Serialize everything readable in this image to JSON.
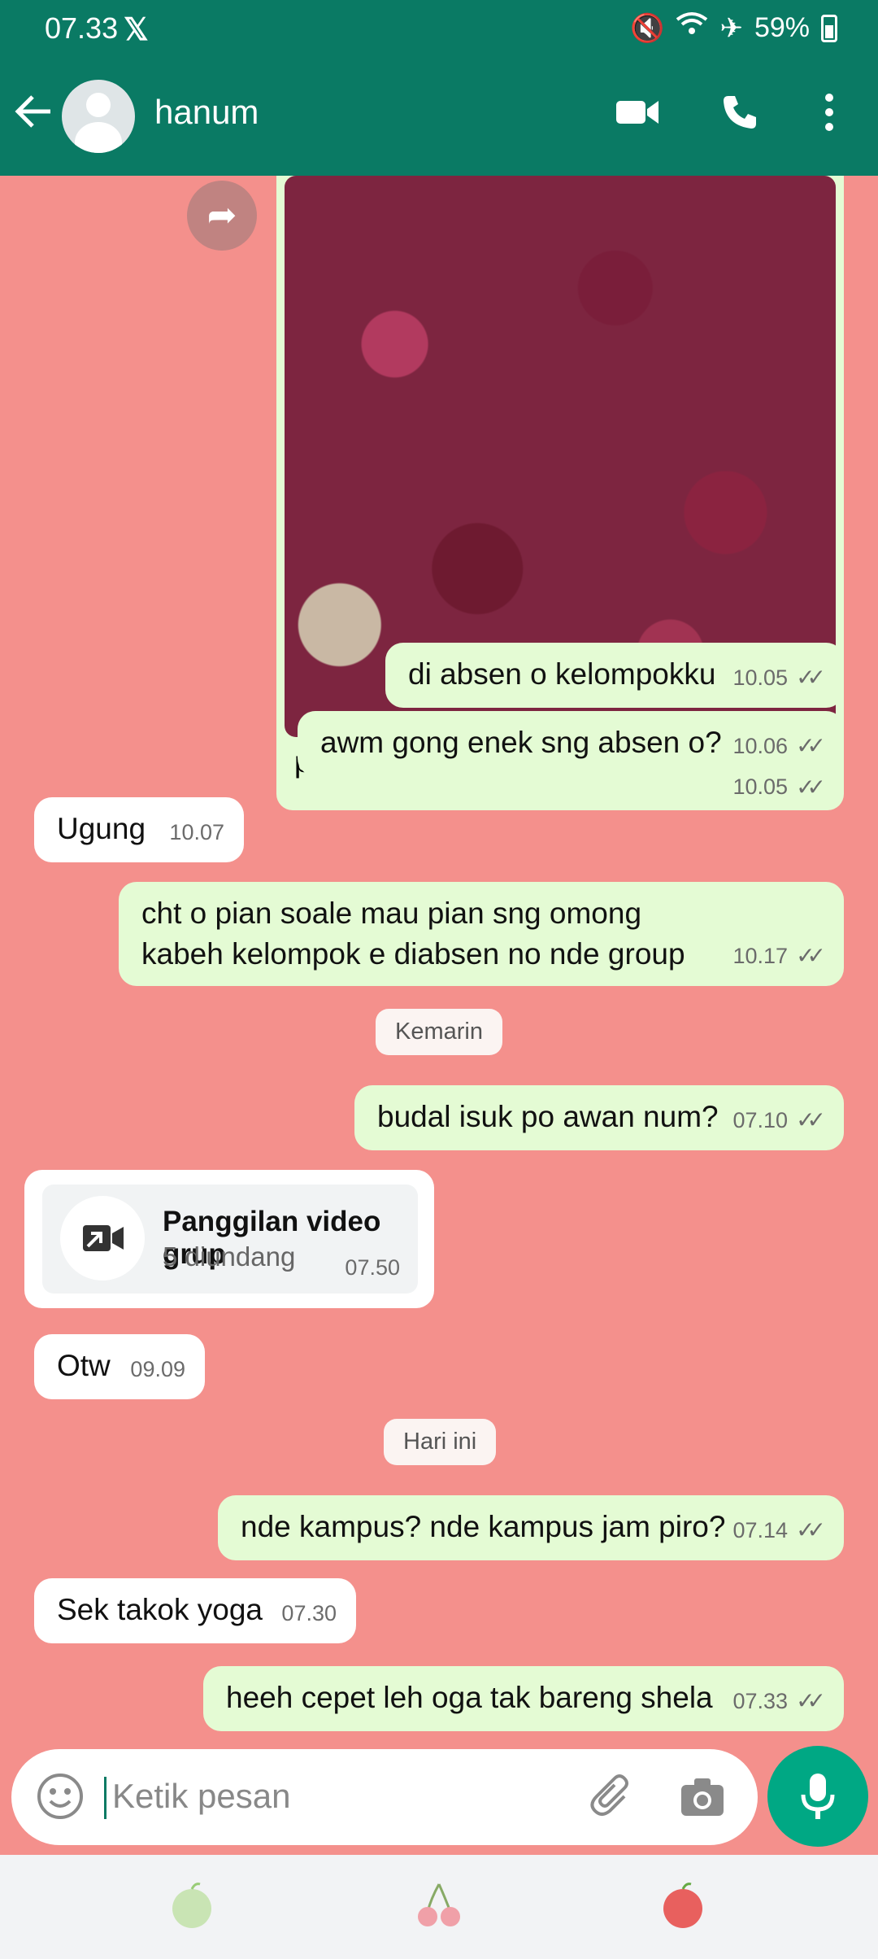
{
  "status_bar": {
    "time": "07.33",
    "app_icon": "x-logo",
    "battery": "59%"
  },
  "header": {
    "contact_name": "hanum",
    "icons": [
      "back-arrow-icon",
      "avatar",
      "video-call-icon",
      "phone-icon",
      "more-options-icon"
    ]
  },
  "messages": {
    "photo": {
      "caption": "pritil",
      "time": "10.05"
    },
    "m1": {
      "text": "di absen o kelompokku",
      "time": "10.05"
    },
    "m2": {
      "text": "awm gong enek sng absen o?",
      "time": "10.06"
    },
    "m3": {
      "text": "Ugung",
      "time": "10.07"
    },
    "m4": {
      "text": "cht o pian soale mau pian sng omong kabeh kelompok e diabsen no nde group",
      "time": "10.17"
    },
    "day1": "Kemarin",
    "m5": {
      "text": "budal isuk po awan num?",
      "time": "07.10"
    },
    "call": {
      "title": "Panggilan video grup",
      "subtitle": "5 diundang",
      "time": "07.50"
    },
    "m6": {
      "text": "Otw",
      "time": "09.09"
    },
    "day2": "Hari ini",
    "m7": {
      "text": "nde kampus? nde kampus jam piro?",
      "time": "07.14"
    },
    "m8": {
      "text": "Sek takok yoga",
      "time": "07.30"
    },
    "m9": {
      "text": "heeh cepet leh oga tak bareng shela",
      "time": "07.33"
    }
  },
  "composer": {
    "placeholder": "Ketik pesan"
  },
  "colors": {
    "header": "#0a7a64",
    "chat_bg": "#f4908c",
    "outgoing": "#e4fbd4",
    "incoming": "#ffffff",
    "accent": "#00a884"
  }
}
